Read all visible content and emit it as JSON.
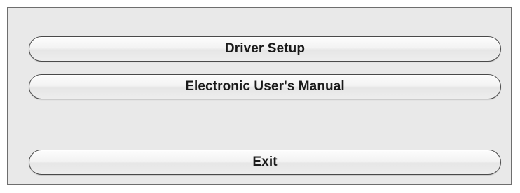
{
  "buttons": {
    "driver_setup": "Driver Setup",
    "user_manual": "Electronic User's Manual",
    "exit": "Exit"
  },
  "colors": {
    "panel_background": "#e9e9e9",
    "panel_border": "#6e6e6e",
    "button_border": "#4a4a4a",
    "button_text": "#1a1a1a"
  }
}
